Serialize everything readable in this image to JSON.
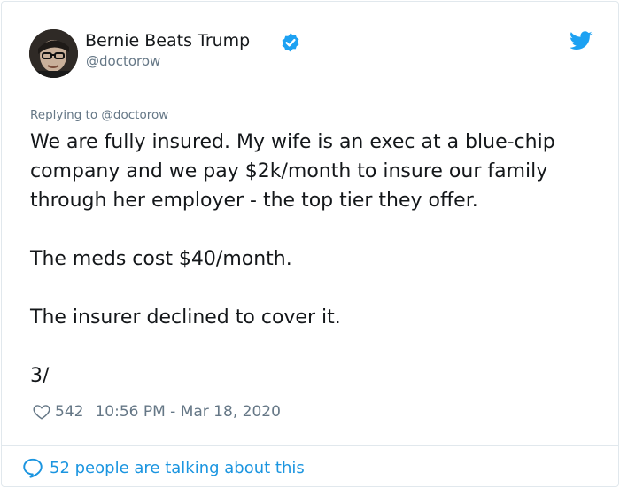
{
  "tweet": {
    "display_name": "Bernie Beats Trump",
    "handle": "@doctorow",
    "replying_prefix": "Replying to",
    "replying_handle": "@doctorow",
    "paragraphs": [
      "We are fully insured. My wife is an exec at a blue-chip company and we pay $2k/month to insure our family through her employer - the top tier they offer.",
      "The meds cost $40/month.",
      "The insurer declined to cover it.",
      "3/"
    ],
    "likes": "542",
    "timestamp": "10:56 PM - Mar 18, 2020",
    "conversation": "52 people are talking about this"
  },
  "icons": {
    "verified": "verified-badge-icon",
    "brand": "twitter-bird-icon",
    "like": "heart-icon",
    "reply": "speech-bubble-icon"
  },
  "colors": {
    "brand_blue": "#1da1f2",
    "link_blue": "#1b95e0",
    "text": "#14171a",
    "muted": "#657786",
    "border": "#e1e8ed"
  }
}
